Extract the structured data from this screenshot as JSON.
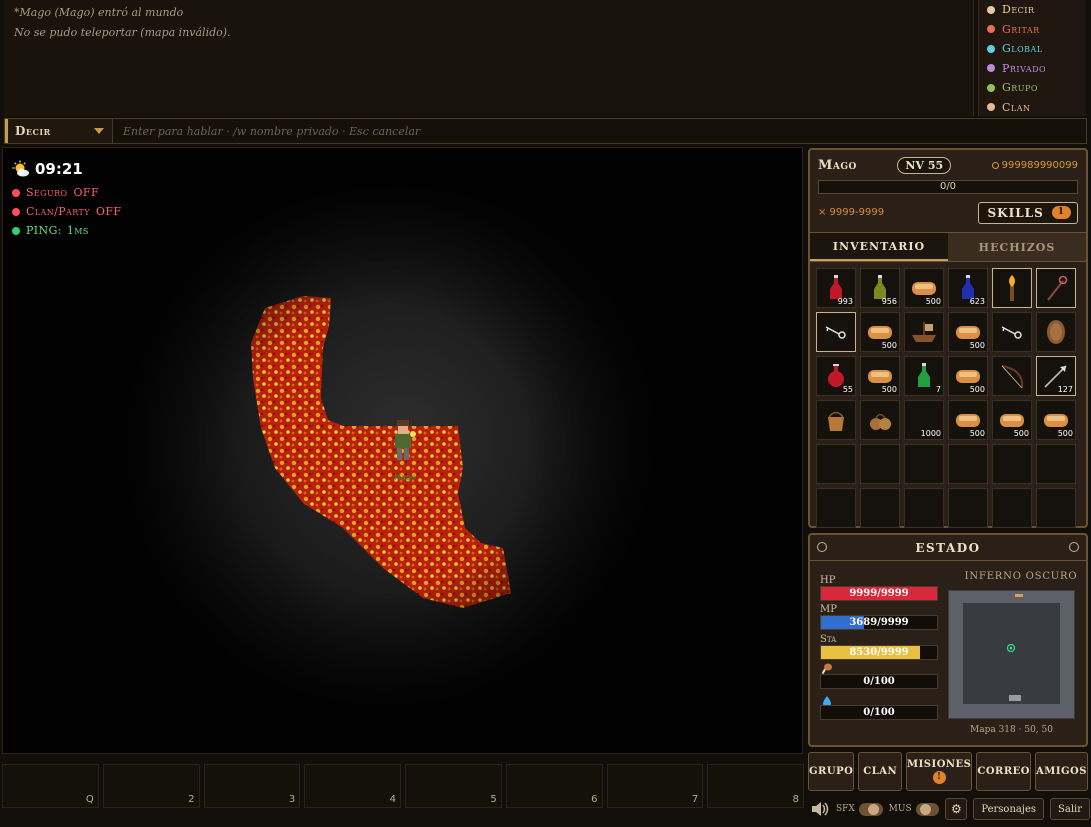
{
  "chat": {
    "messages": [
      "*Mago (Mago) entró al mundo",
      "No se pudo teleportar (mapa inválido)."
    ],
    "channels": [
      {
        "label": "Decir",
        "color": "#e8cca0"
      },
      {
        "label": "Gritar",
        "color": "#e8704e"
      },
      {
        "label": "Global",
        "color": "#5fd0e0"
      },
      {
        "label": "Privado",
        "color": "#c08ad8"
      },
      {
        "label": "Grupo",
        "color": "#90c060"
      },
      {
        "label": "Clan",
        "color": "#e8b890"
      }
    ],
    "selected_channel": "Decir",
    "input_placeholder": "Enter para hablar · /w nombre privado · Esc cancelar"
  },
  "hud": {
    "time": "09:21",
    "weather_icon": "partly-cloudy-icon",
    "seguro_label": "Seguro",
    "seguro_value": "OFF",
    "clan_label": "Clan/Party",
    "clan_value": "OFF",
    "ping_label": "PING:",
    "ping_value": "1ms",
    "colors": {
      "off": "#ff4d5e",
      "ok": "#35d06a"
    }
  },
  "hotbar": [
    "Q",
    "2",
    "3",
    "4",
    "5",
    "6",
    "7",
    "8"
  ],
  "character": {
    "name": "Mago",
    "level": "NV 55",
    "gold": "999989990099",
    "xp": "0/0",
    "damage": "× 9999-9999",
    "skills_label": "SKILLS",
    "skills_badge": "1"
  },
  "tabs": {
    "inventory": "INVENTARIO",
    "spells": "HECHIZOS"
  },
  "inventory": [
    {
      "icon": "red-potion-icon",
      "qty": "993",
      "sel": false
    },
    {
      "icon": "yellow-potion-icon",
      "qty": "956",
      "sel": false
    },
    {
      "icon": "bread-icon",
      "qty": "500",
      "sel": false
    },
    {
      "icon": "blue-potion-icon",
      "qty": "623",
      "sel": false
    },
    {
      "icon": "torch-icon",
      "qty": "",
      "sel": true
    },
    {
      "icon": "staff-icon",
      "qty": "",
      "sel": true
    },
    {
      "icon": "key-icon",
      "qty": "",
      "sel": true
    },
    {
      "icon": "bread-icon",
      "qty": "500",
      "sel": false
    },
    {
      "icon": "boat-icon",
      "qty": "",
      "sel": false
    },
    {
      "icon": "bread-icon",
      "qty": "500",
      "sel": false
    },
    {
      "icon": "key-icon",
      "qty": "",
      "sel": false
    },
    {
      "icon": "shield-icon",
      "qty": "",
      "sel": false
    },
    {
      "icon": "red-flask-icon",
      "qty": "55",
      "sel": false
    },
    {
      "icon": "bread-icon",
      "qty": "500",
      "sel": false
    },
    {
      "icon": "green-potion-icon",
      "qty": "7",
      "sel": false
    },
    {
      "icon": "bread-icon",
      "qty": "500",
      "sel": false
    },
    {
      "icon": "bow-icon",
      "qty": "",
      "sel": false
    },
    {
      "icon": "arrow-icon",
      "qty": "127",
      "sel": true
    },
    {
      "icon": "bucket-icon",
      "qty": "",
      "sel": false
    },
    {
      "icon": "pouch-icon",
      "qty": "",
      "sel": false
    },
    {
      "icon": "empty-icon",
      "qty": "1000",
      "sel": false
    },
    {
      "icon": "bread-icon",
      "qty": "500",
      "sel": false
    },
    {
      "icon": "bread-icon",
      "qty": "500",
      "sel": false
    },
    {
      "icon": "bread-icon",
      "qty": "500",
      "sel": false
    },
    {
      "icon": "",
      "qty": "",
      "sel": false
    },
    {
      "icon": "",
      "qty": "",
      "sel": false
    },
    {
      "icon": "",
      "qty": "",
      "sel": false
    },
    {
      "icon": "",
      "qty": "",
      "sel": false
    },
    {
      "icon": "",
      "qty": "",
      "sel": false
    },
    {
      "icon": "",
      "qty": "",
      "sel": false
    },
    {
      "icon": "",
      "qty": "",
      "sel": false
    },
    {
      "icon": "",
      "qty": "",
      "sel": false
    },
    {
      "icon": "",
      "qty": "",
      "sel": false
    },
    {
      "icon": "",
      "qty": "",
      "sel": false
    },
    {
      "icon": "",
      "qty": "",
      "sel": false
    },
    {
      "icon": "",
      "qty": "",
      "sel": false
    }
  ],
  "status": {
    "title": "ESTADO",
    "hp_label": "HP",
    "hp_text": "9999/9999",
    "hp_fraction": 1.0,
    "hp_color": "#d8283c",
    "mp_label": "MP",
    "mp_text": "3689/9999",
    "mp_fraction": 0.369,
    "mp_color": "#2f6fd0",
    "sta_label": "Sta",
    "sta_text": "8530/9999",
    "sta_fraction": 0.853,
    "sta_color": "#e8c040",
    "food_icon": "drumstick-icon",
    "food_text": "0/100",
    "water_icon": "water-drop-icon",
    "water_text": "0/100"
  },
  "minimap": {
    "title": "INFERNO OSCURO",
    "caption": "Mapa 318 · 50, 50"
  },
  "menu": {
    "group": "GRUPO",
    "clan": "CLAN",
    "missions": "MISIONES",
    "missions_badge": "!",
    "mail": "CORREO",
    "friends": "AMIGOS"
  },
  "footer": {
    "sfx": "SFX",
    "mus": "MUS",
    "characters": "Personajes",
    "exit": "Salir"
  }
}
